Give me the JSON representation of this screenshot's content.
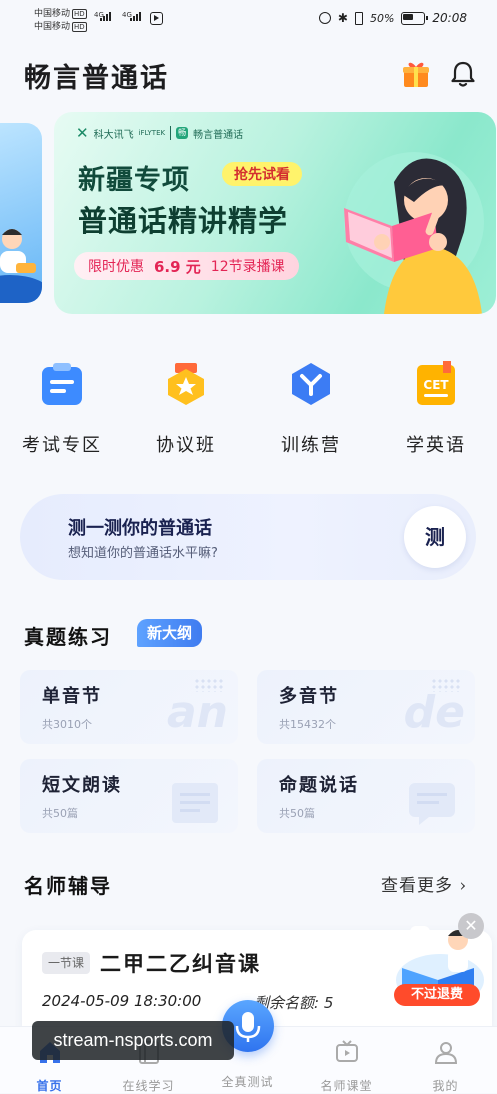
{
  "status_bar": {
    "carrier1": "中国移动",
    "carrier2": "中国移动",
    "hd": "HD",
    "net1": "4G",
    "net2": "4G",
    "battery_pct": "50%",
    "time": "20:08"
  },
  "header": {
    "title": "畅言普通话",
    "gift_icon": "gift-icon",
    "bell_icon": "bell-icon"
  },
  "banner": {
    "brand_main": "科大讯飞",
    "brand_sub": "iFLYTEK",
    "brand_app": "畅言普通话",
    "line1": "新疆专项",
    "tag": "抢先试看",
    "line2": "普通话精讲精学",
    "promo_label": "限时优惠",
    "promo_price": "6.9 元",
    "promo_lessons": "12节录播课"
  },
  "quick_entries": [
    {
      "label": "考试专区",
      "icon": "exam-icon",
      "color": "#3d8bff"
    },
    {
      "label": "协议班",
      "icon": "medal-icon",
      "color": "#ffc01e"
    },
    {
      "label": "训练营",
      "icon": "hexagon-y-icon",
      "color": "#3c7cf4"
    },
    {
      "label": "学英语",
      "icon": "cet-icon",
      "color": "#ffb300"
    }
  ],
  "test_card": {
    "title": "测一测你的普通话",
    "subtitle": "想知道你的普通话水平嘛?",
    "button": "测"
  },
  "practice": {
    "title": "真题练习",
    "badge": "新大纲",
    "cards": [
      {
        "title": "单音节",
        "count": "共3010个",
        "deco": "an"
      },
      {
        "title": "多音节",
        "count": "共15432个",
        "deco": "de"
      },
      {
        "title": "短文朗读",
        "count": "共50篇",
        "deco": ""
      },
      {
        "title": "命题说话",
        "count": "共50篇",
        "deco": ""
      }
    ]
  },
  "teachers": {
    "title": "名师辅导",
    "more": "查看更多",
    "lesson": {
      "tag": "一节课",
      "title": "二甲二乙纠音课",
      "date": "2024-05-09 18:30:00",
      "quota": "剩余名额: 5"
    },
    "float_promo": "不过退费"
  },
  "tabbar": [
    {
      "label": "首页",
      "icon": "home-icon",
      "active": true
    },
    {
      "label": "在线学习",
      "icon": "book-icon",
      "active": false
    },
    {
      "label": "全真测试",
      "icon": "mic-icon",
      "active": false
    },
    {
      "label": "名师课堂",
      "icon": "tv-icon",
      "active": false
    },
    {
      "label": "我的",
      "icon": "user-icon",
      "active": false
    }
  ],
  "watermark": "stream-nsports.com",
  "colors": {
    "accent": "#3771ea",
    "banner_green": "#8be8cc",
    "promo_red": "#e32555"
  }
}
